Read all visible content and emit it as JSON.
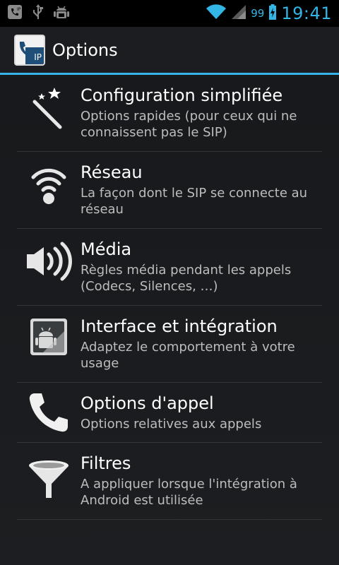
{
  "status_bar": {
    "battery_text": "99",
    "time": "19:41",
    "icons": [
      "sip-icon",
      "usb-icon",
      "android-debug-icon",
      "wifi-icon",
      "signal-icon",
      "battery-charging-icon"
    ]
  },
  "action_bar": {
    "title": "Options",
    "app_icon_label": "IP"
  },
  "items": [
    {
      "icon": "magic-wand-icon",
      "title": "Configuration simplifiée",
      "subtitle": "Options rapides (pour ceux qui ne connaissent pas le SIP)"
    },
    {
      "icon": "wifi-network-icon",
      "title": "Réseau",
      "subtitle": "La façon dont le SIP se connecte au réseau"
    },
    {
      "icon": "speaker-icon",
      "title": "Média",
      "subtitle": "Règles média pendant les appels (Codecs, Silences, …)"
    },
    {
      "icon": "android-interface-icon",
      "title": "Interface et intégration",
      "subtitle": "Adaptez le comportement à votre usage"
    },
    {
      "icon": "phone-handset-icon",
      "title": "Options d'appel",
      "subtitle": "Options relatives aux appels"
    },
    {
      "icon": "funnel-filter-icon",
      "title": "Filtres",
      "subtitle": "A appliquer lorsque l'intégration à Android est utilisée"
    }
  ],
  "colors": {
    "accent": "#33b5e5",
    "background": "#1a1c1f",
    "subtitle": "#bdbdbd"
  }
}
